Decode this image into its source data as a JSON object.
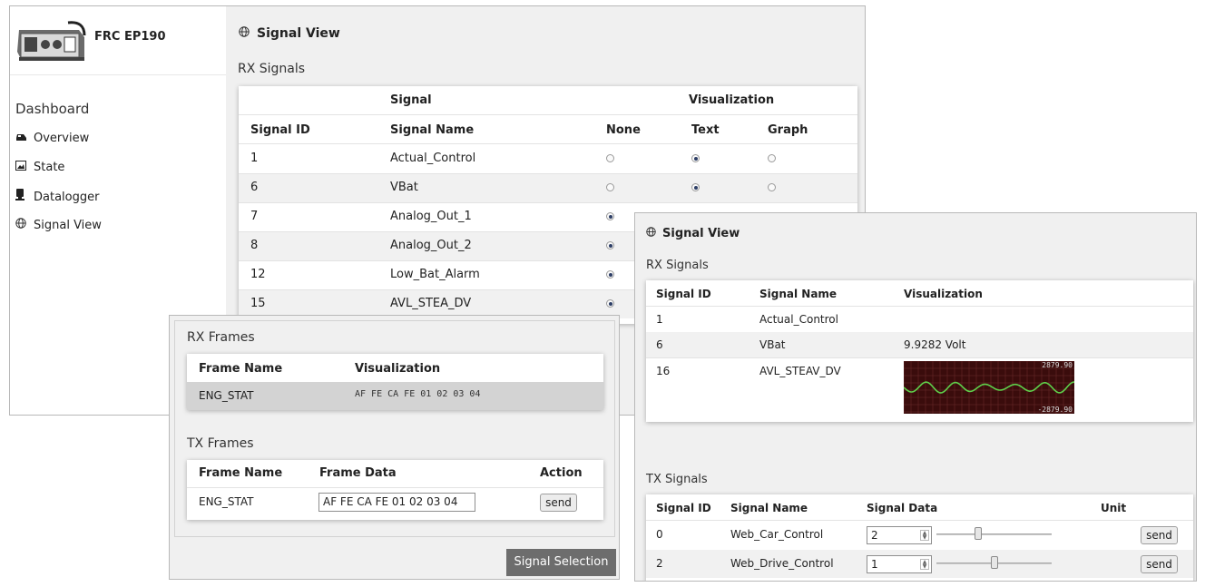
{
  "app": {
    "device_name": "FRC EP190"
  },
  "sidebar": {
    "heading": "Dashboard",
    "items": [
      {
        "label": "Overview",
        "icon": "car-icon"
      },
      {
        "label": "State",
        "icon": "image-icon"
      },
      {
        "label": "Datalogger",
        "icon": "logger-icon"
      },
      {
        "label": "Signal View",
        "icon": "globe-icon"
      }
    ]
  },
  "main": {
    "title": "Signal View",
    "rx_section": "RX Signals",
    "group_headers": {
      "signal": "Signal",
      "visualization": "Visualization"
    },
    "columns": [
      "Signal ID",
      "Signal Name",
      "None",
      "Text",
      "Graph"
    ],
    "rows": [
      {
        "id": "1",
        "name": "Actual_Control",
        "selected": "Text"
      },
      {
        "id": "6",
        "name": "VBat",
        "selected": "Text"
      },
      {
        "id": "7",
        "name": "Analog_Out_1",
        "selected": "None"
      },
      {
        "id": "8",
        "name": "Analog_Out_2",
        "selected": "None"
      },
      {
        "id": "12",
        "name": "Low_Bat_Alarm",
        "selected": "None"
      },
      {
        "id": "15",
        "name": "AVL_STEA_DV",
        "selected": "None"
      }
    ]
  },
  "frames": {
    "rx_title": "RX Frames",
    "rx_columns": [
      "Frame Name",
      "Visualization"
    ],
    "rx_rows": [
      {
        "name": "ENG_STAT",
        "data": "AF FE CA FE 01 02 03 04"
      }
    ],
    "tx_title": "TX Frames",
    "tx_columns": [
      "Frame Name",
      "Frame Data",
      "Action"
    ],
    "tx_rows": [
      {
        "name": "ENG_STAT",
        "data": "AF FE CA FE 01 02 03 04",
        "action": "send"
      }
    ],
    "selection_button": "Signal Selection"
  },
  "view": {
    "title": "Signal View",
    "rx_section": "RX Signals",
    "rx_columns": [
      "Signal ID",
      "Signal Name",
      "Visualization"
    ],
    "rx_rows": [
      {
        "id": "1",
        "name": "Actual_Control",
        "value": ""
      },
      {
        "id": "6",
        "name": "VBat",
        "value": "9.9282 Volt"
      },
      {
        "id": "16",
        "name": "AVL_STEAV_DV",
        "value": ""
      }
    ],
    "graph": {
      "max_label": "2879.90",
      "min_label": "-2879.90",
      "background": "#3a0c0c",
      "line_color": "#5fd04a"
    },
    "tx_section": "TX Signals",
    "tx_columns": [
      "Signal ID",
      "Signal Name",
      "Signal Data",
      "Unit"
    ],
    "tx_rows": [
      {
        "id": "0",
        "name": "Web_Car_Control",
        "value": "2",
        "slider_level": 0.35,
        "action": "send"
      },
      {
        "id": "2",
        "name": "Web_Drive_Control",
        "value": "1",
        "slider_level": 0.5,
        "action": "send"
      }
    ]
  }
}
